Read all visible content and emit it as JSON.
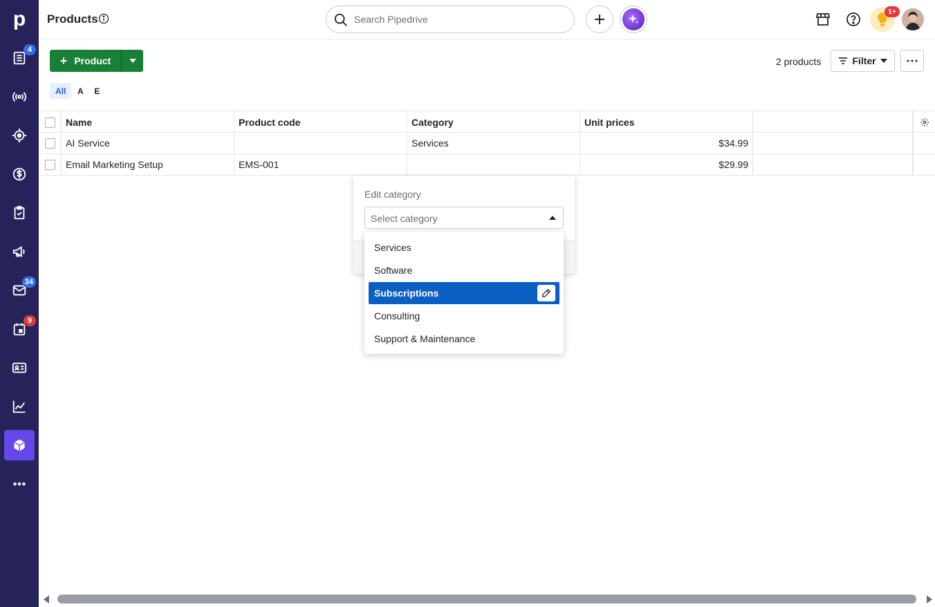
{
  "sidebar": {
    "logo": "p",
    "items": [
      {
        "name": "leads-icon",
        "badge": "4"
      },
      {
        "name": "deals-radar-icon",
        "badge": ""
      },
      {
        "name": "target-icon",
        "badge": ""
      },
      {
        "name": "dollar-icon",
        "badge": ""
      },
      {
        "name": "clipboard-check-icon",
        "badge": ""
      },
      {
        "name": "megaphone-icon",
        "badge": ""
      },
      {
        "name": "mail-icon",
        "badge": "34"
      },
      {
        "name": "calendar-icon",
        "badge": "9"
      },
      {
        "name": "contacts-card-icon",
        "badge": ""
      },
      {
        "name": "insights-chart-icon",
        "badge": ""
      },
      {
        "name": "products-box-icon",
        "badge": ""
      },
      {
        "name": "more-dots-icon",
        "badge": ""
      }
    ]
  },
  "topbar": {
    "title": "Products",
    "search_placeholder": "Search Pipedrive",
    "notifications_badge": "1+"
  },
  "toolbar": {
    "add_label": "Product",
    "count_label": "2 products",
    "filter_label": "Filter",
    "letters": [
      "All",
      "A",
      "E"
    ]
  },
  "table": {
    "columns": [
      "Name",
      "Product code",
      "Category",
      "Unit prices"
    ],
    "rows": [
      {
        "name": "AI Service",
        "code": "",
        "category": "Services",
        "price": "$34.99"
      },
      {
        "name": "Email Marketing Setup",
        "code": "EMS-001",
        "category": "",
        "price": "$29.99"
      }
    ]
  },
  "popover": {
    "label": "Edit category",
    "select_placeholder": "Select category",
    "options": [
      "Services",
      "Software",
      "Subscriptions",
      "Consulting",
      "Support & Maintenance"
    ],
    "highlighted": "Subscriptions"
  },
  "colors": {
    "sidebar_bg": "#26235b",
    "accent_green": "#1a7f37",
    "active_nav": "#6447e6",
    "selected_option": "#0b5fc2"
  }
}
